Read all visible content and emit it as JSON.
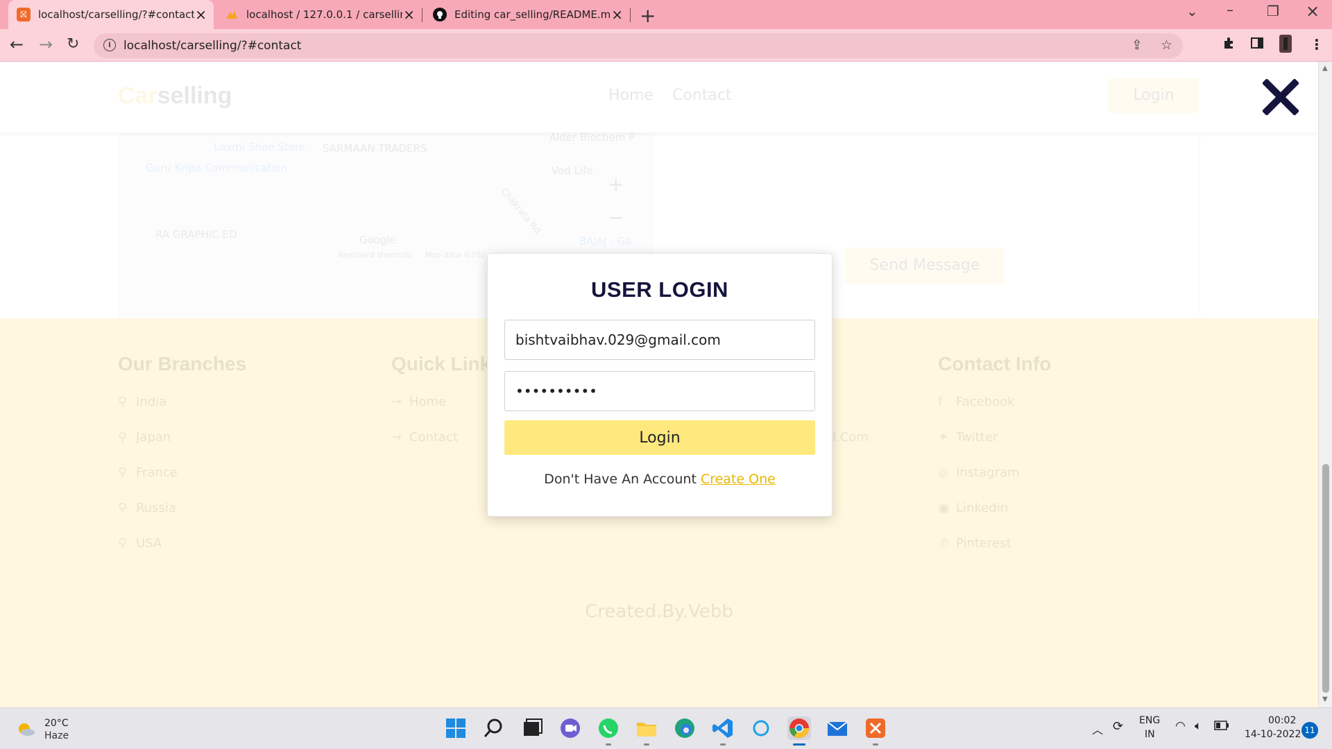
{
  "browser": {
    "tabs": [
      {
        "title": "localhost/carselling/?#contact",
        "active": true
      },
      {
        "title": "localhost / 127.0.0.1 / carselling /",
        "active": false
      },
      {
        "title": "Editing car_selling/README.md a",
        "active": false
      }
    ],
    "url": "localhost/carselling/?#contact"
  },
  "site": {
    "logo_part1": "Car",
    "logo_part2": "selling",
    "nav": [
      "Home",
      "Contact"
    ],
    "login_label": "Login",
    "send_message_label": "Send Message",
    "map_labels": [
      "Laxmi Shoe Store",
      "SARMAAN TRADERS",
      "Guru Kripa Communication",
      "Ved Life",
      "RA GRAPHIC ED",
      "Google",
      "Keyboard shortcuts",
      "Map data ©202",
      "BAJAJ - Ga",
      "Chakrata Rd",
      "Alder Biochem P"
    ]
  },
  "footer": {
    "branches_heading": "Our Branches",
    "branches": [
      "India",
      "Japan",
      "France",
      "Russia",
      "USA"
    ],
    "quick_heading": "Quick Link",
    "quick_links": [
      "Home",
      "Contact"
    ],
    "email_fragment": "l.Com",
    "contact_heading": "Contact Info",
    "contact_links": [
      "Facebook",
      "Twitter",
      "Instagram",
      "Linkedin",
      "Pinterest"
    ],
    "credit": "Created.By.Vebb"
  },
  "modal": {
    "title": "USER LOGIN",
    "email_value": "bishtvaibhav.029@gmail.com",
    "password_value": "vaibhav123",
    "login_button": "Login",
    "signup_text": "Don't Have An Account",
    "signup_link": "Create One"
  },
  "taskbar": {
    "temperature": "20°C",
    "condition": "Haze",
    "lang1": "ENG",
    "lang2": "IN",
    "time": "00:02",
    "date": "14-10-2022",
    "notifications": "11"
  }
}
